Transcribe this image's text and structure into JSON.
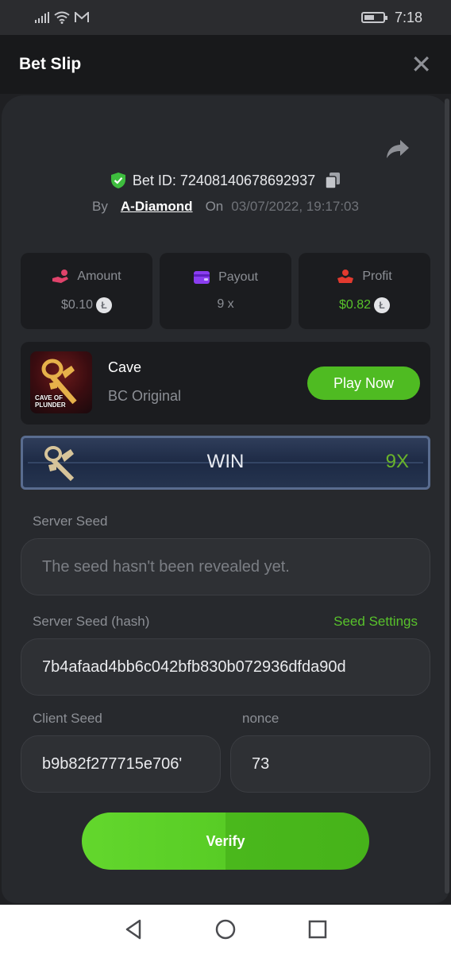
{
  "status_bar": {
    "time": "7:18",
    "icons": [
      "signal-icon",
      "wifi-icon",
      "mail-icon",
      "battery-icon"
    ]
  },
  "header": {
    "title": "Bet Slip",
    "close_icon": "close-icon"
  },
  "bet": {
    "id_text": "Bet ID: 724081406786929​37",
    "by_label": "By",
    "username": "A-Diamond",
    "on_label": "On",
    "date": "03/07/2022, 19:17:03"
  },
  "stats": {
    "amount": {
      "label": "Amount",
      "value": "$0.10",
      "icon": "hand-coins-icon"
    },
    "payout": {
      "label": "Payout",
      "value": "9 x",
      "icon": "wallet-icon"
    },
    "profit": {
      "label": "Profit",
      "value": "$0.82",
      "icon": "profit-hand-icon"
    },
    "coin_symbol": "Ł"
  },
  "game": {
    "name": "Cave",
    "subtitle": "BC Original",
    "thumb_text_line1": "CAVE OF",
    "thumb_text_line2": "PLUNDER",
    "play_label": "Play Now"
  },
  "result": {
    "label": "WIN",
    "multiplier": "9X"
  },
  "seeds": {
    "server_seed_label": "Server Seed",
    "server_seed_value": "The seed hasn't been revealed yet.",
    "server_hash_label": "Server Seed (hash)",
    "seed_settings_label": "Seed Settings",
    "server_hash_value": "7b4afaad4bb6c042bfb830b072936dfda90d",
    "client_seed_label": "Client Seed",
    "client_seed_value": "b9b82f277715e706'",
    "nonce_label": "nonce",
    "nonce_value": "73"
  },
  "verify_label": "Verify",
  "colors": {
    "accent_green": "#58c22b",
    "background": "#27292d",
    "card": "#1b1c1f"
  }
}
